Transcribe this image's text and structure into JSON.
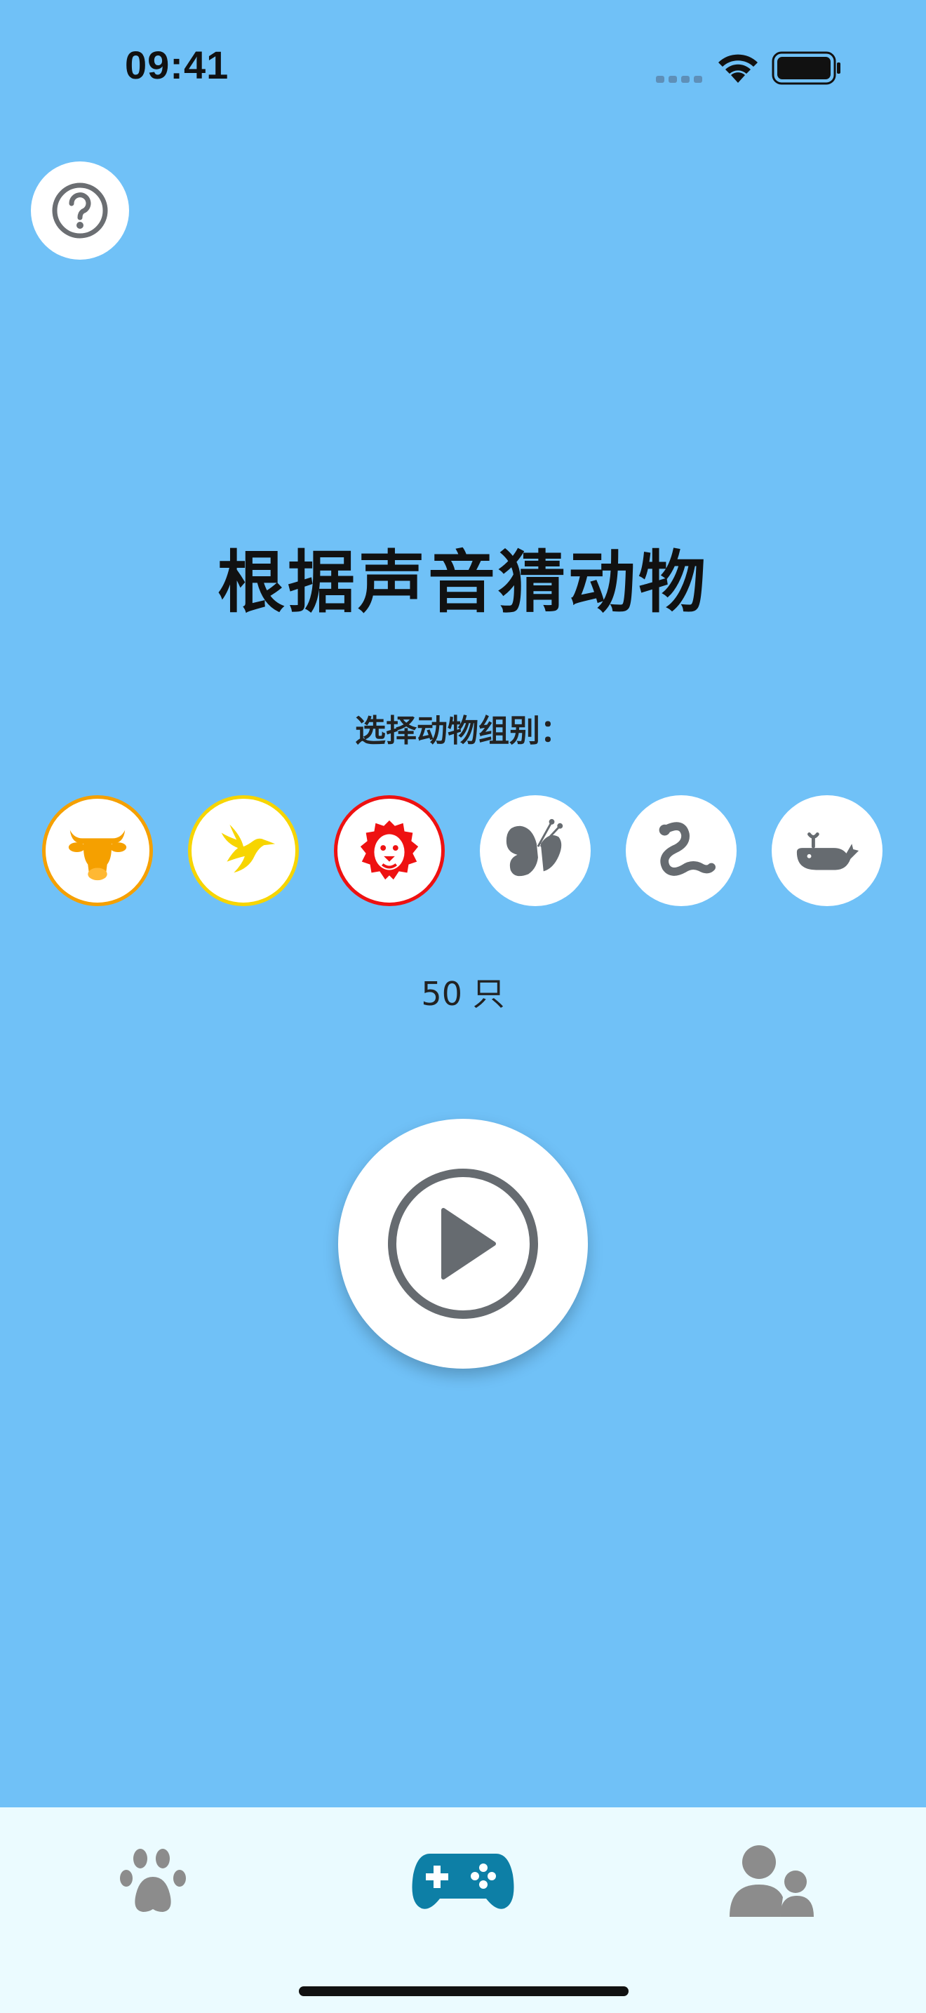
{
  "status_bar": {
    "time": "09:41"
  },
  "header": {
    "help_icon": "question-circle-icon"
  },
  "main": {
    "title": "根据声音猜动物",
    "group_label": "选择动物组别：",
    "groups": [
      {
        "icon": "cow-icon",
        "color": "#F5A000",
        "selected": true
      },
      {
        "icon": "bird-icon",
        "color": "#F7D500",
        "selected": true
      },
      {
        "icon": "lion-icon",
        "color": "#EE1111",
        "selected": true
      },
      {
        "icon": "butterfly-icon",
        "color": "#666B70",
        "selected": false
      },
      {
        "icon": "snake-icon",
        "color": "#666B70",
        "selected": false
      },
      {
        "icon": "whale-icon",
        "color": "#666B70",
        "selected": false
      }
    ],
    "count": "50 只",
    "play_icon": "play-circle-icon"
  },
  "tab_bar": {
    "tabs": [
      {
        "icon": "paw-icon",
        "active": false
      },
      {
        "icon": "gamepad-icon",
        "active": true
      },
      {
        "icon": "users-icon",
        "active": false
      }
    ],
    "active_color": "#0D7FA6",
    "inactive_color": "#8C8C8C"
  }
}
